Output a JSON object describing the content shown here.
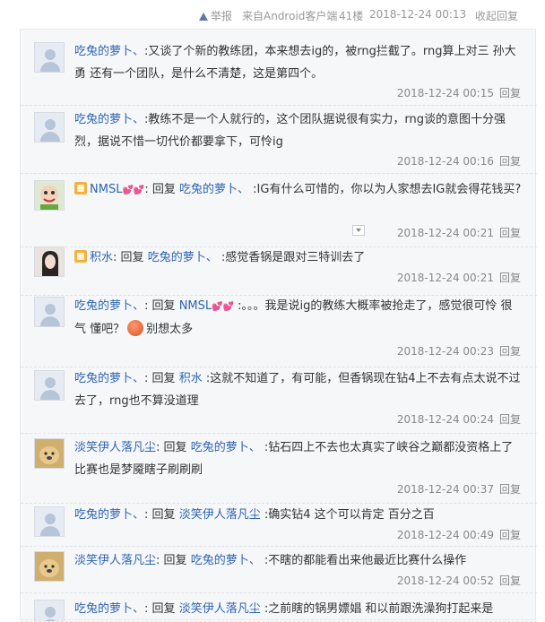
{
  "header": {
    "report_label": "举报",
    "client_label": "来自Android客户端",
    "floor_label": "41楼",
    "time": "2018-12-24 00:13",
    "collapse_label": "收起回复"
  },
  "reply_word": "回复",
  "comments": [
    {
      "user": "吃兔的萝卜、",
      "text": "又谈了个新的教练团，本来想去ig的，被rng拦截了。rng算上对三 孙大勇 还有一个团队，是什么不清楚，这是第四个。",
      "time": "2018-12-24 00:15"
    },
    {
      "user": "吃兔的萝卜、",
      "text": "教练不是一个人就行的，这个团队据说很有实力，rng谈的意图十分强烈，据说不惜一切代价都要拿下，可怜ig",
      "time": "2018-12-24 00:16"
    },
    {
      "user": "NMSL",
      "hearts": "💕💕",
      "to": "吃兔的萝卜、",
      "text": ":IG有什么可惜的，你以为人家想去IG就会得花钱买?",
      "time": "2018-12-24 00:21"
    },
    {
      "user": "积水",
      "to": "吃兔的萝卜、",
      "text": ":感觉香锅是跟对三特训去了",
      "time": "2018-12-24 00:21"
    },
    {
      "user": "吃兔的萝卜、",
      "to": "NMSL",
      "to_hearts": "💕💕",
      "text": ":。。。我是说ig的教练大概率被抢走了，感觉很可怜 很气 懂吧？",
      "text2": "别想太多",
      "time": "2018-12-24 00:23"
    },
    {
      "user": "吃兔的萝卜、",
      "to": "积水",
      "text": ":这就不知道了，有可能，但香锅现在钻4上不去有点太说不过去了，rng也不算没道理",
      "time": "2018-12-24 00:24"
    },
    {
      "user": "淡笑伊人落凡尘",
      "to": "吃兔的萝卜、",
      "text": ":钻石四上不去也太真实了峡谷之巅都没资格上了比赛也是梦魇瞎子刷刷刷",
      "time": "2018-12-24 00:37"
    },
    {
      "user": "吃兔的萝卜、",
      "to": "淡笑伊人落凡尘",
      "text": ":确实钻4 这个可以肯定 百分之百",
      "time": "2018-12-24 00:49"
    },
    {
      "user": "淡笑伊人落凡尘",
      "to": "吃兔的萝卜、",
      "text": ":不瞎的都能看出来他最近比赛什么操作",
      "time": "2018-12-24 00:52"
    },
    {
      "user": "吃兔的萝卜、",
      "to": "淡笑伊人落凡尘",
      "text": ":之前瞎的锅男嫖娼 和以前跟洗澡狗打起来是"
    }
  ]
}
